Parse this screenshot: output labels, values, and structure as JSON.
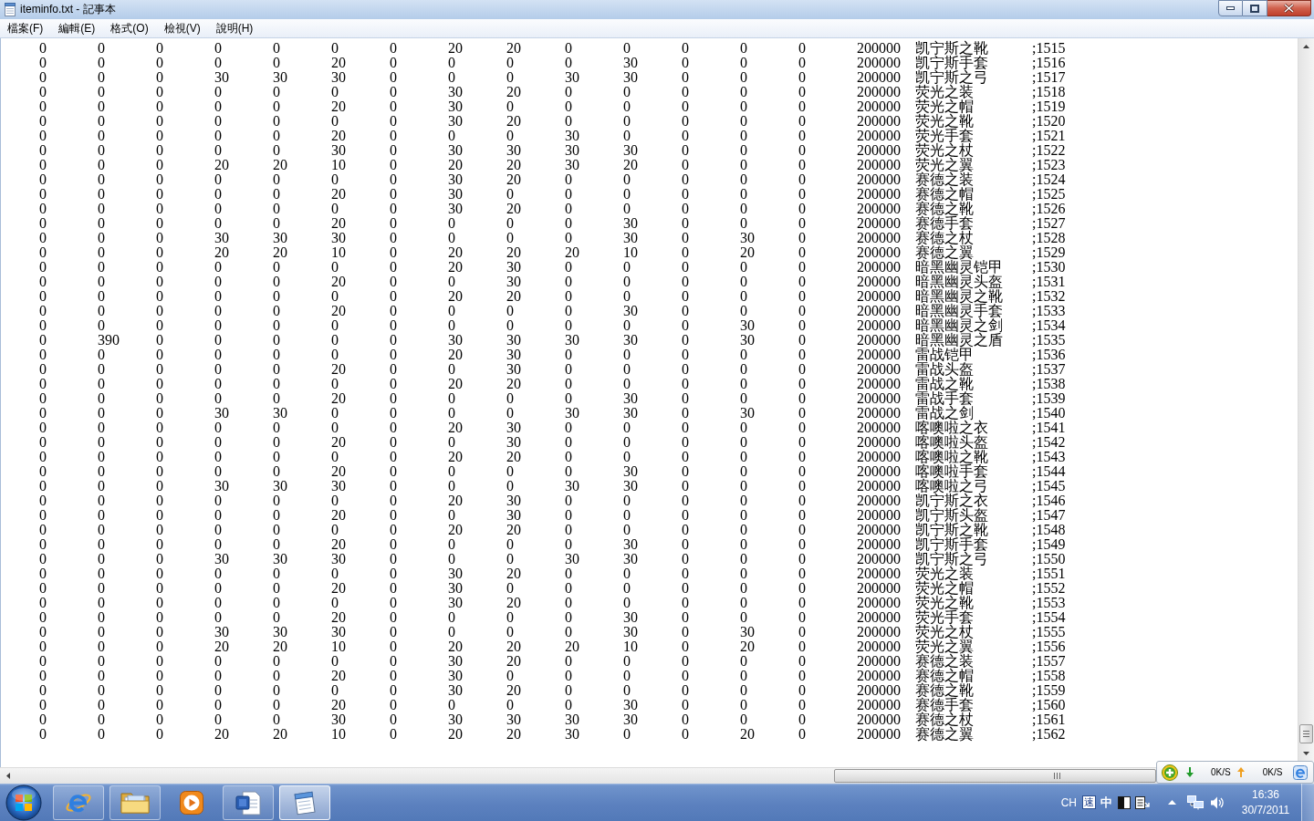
{
  "window": {
    "title": "iteminfo.txt - 記事本"
  },
  "menu": [
    "檔案(F)",
    "編輯(E)",
    "格式(O)",
    "檢視(V)",
    "說明(H)"
  ],
  "lines": [
    [
      "0",
      "0",
      "0",
      "0",
      "0",
      "0",
      "0",
      "20",
      "20",
      "0",
      "0",
      "0",
      "0",
      "0",
      "200000",
      "凯宁斯之靴",
      ";1515"
    ],
    [
      "0",
      "0",
      "0",
      "0",
      "0",
      "20",
      "0",
      "0",
      "0",
      "0",
      "30",
      "0",
      "0",
      "0",
      "200000",
      "凯宁斯手套",
      ";1516"
    ],
    [
      "0",
      "0",
      "0",
      "30",
      "30",
      "30",
      "0",
      "0",
      "0",
      "30",
      "30",
      "0",
      "0",
      "0",
      "200000",
      "凯宁斯之弓",
      ";1517"
    ],
    [
      "0",
      "0",
      "0",
      "0",
      "0",
      "0",
      "0",
      "30",
      "20",
      "0",
      "0",
      "0",
      "0",
      "0",
      "200000",
      "荧光之装",
      ";1518"
    ],
    [
      "0",
      "0",
      "0",
      "0",
      "0",
      "20",
      "0",
      "30",
      "0",
      "0",
      "0",
      "0",
      "0",
      "0",
      "200000",
      "荧光之帽",
      ";1519"
    ],
    [
      "0",
      "0",
      "0",
      "0",
      "0",
      "0",
      "0",
      "30",
      "20",
      "0",
      "0",
      "0",
      "0",
      "0",
      "200000",
      "荧光之靴",
      ";1520"
    ],
    [
      "0",
      "0",
      "0",
      "0",
      "0",
      "20",
      "0",
      "0",
      "0",
      "30",
      "0",
      "0",
      "0",
      "0",
      "200000",
      "荧光手套",
      ";1521"
    ],
    [
      "0",
      "0",
      "0",
      "0",
      "0",
      "30",
      "0",
      "30",
      "30",
      "30",
      "30",
      "0",
      "0",
      "0",
      "200000",
      "荧光之杖",
      ";1522"
    ],
    [
      "0",
      "0",
      "0",
      "20",
      "20",
      "10",
      "0",
      "20",
      "20",
      "30",
      "20",
      "0",
      "0",
      "0",
      "200000",
      "荧光之翼",
      ";1523"
    ],
    [
      "0",
      "0",
      "0",
      "0",
      "0",
      "0",
      "0",
      "30",
      "20",
      "0",
      "0",
      "0",
      "0",
      "0",
      "200000",
      "赛德之装",
      ";1524"
    ],
    [
      "0",
      "0",
      "0",
      "0",
      "0",
      "20",
      "0",
      "30",
      "0",
      "0",
      "0",
      "0",
      "0",
      "0",
      "200000",
      "赛德之帽",
      ";1525"
    ],
    [
      "0",
      "0",
      "0",
      "0",
      "0",
      "0",
      "0",
      "30",
      "20",
      "0",
      "0",
      "0",
      "0",
      "0",
      "200000",
      "赛德之靴",
      ";1526"
    ],
    [
      "0",
      "0",
      "0",
      "0",
      "0",
      "20",
      "0",
      "0",
      "0",
      "0",
      "30",
      "0",
      "0",
      "0",
      "200000",
      "赛德手套",
      ";1527"
    ],
    [
      "0",
      "0",
      "0",
      "30",
      "30",
      "30",
      "0",
      "0",
      "0",
      "0",
      "30",
      "0",
      "30",
      "0",
      "200000",
      "赛德之杖",
      ";1528"
    ],
    [
      "0",
      "0",
      "0",
      "20",
      "20",
      "10",
      "0",
      "20",
      "20",
      "20",
      "10",
      "0",
      "20",
      "0",
      "200000",
      "赛德之翼",
      ";1529"
    ],
    [
      "0",
      "0",
      "0",
      "0",
      "0",
      "0",
      "0",
      "20",
      "30",
      "0",
      "0",
      "0",
      "0",
      "0",
      "200000",
      "暗黑幽灵铠甲",
      ";1530"
    ],
    [
      "0",
      "0",
      "0",
      "0",
      "0",
      "20",
      "0",
      "0",
      "30",
      "0",
      "0",
      "0",
      "0",
      "0",
      "200000",
      "暗黑幽灵头盔",
      ";1531"
    ],
    [
      "0",
      "0",
      "0",
      "0",
      "0",
      "0",
      "0",
      "20",
      "20",
      "0",
      "0",
      "0",
      "0",
      "0",
      "200000",
      "暗黑幽灵之靴",
      ";1532"
    ],
    [
      "0",
      "0",
      "0",
      "0",
      "0",
      "20",
      "0",
      "0",
      "0",
      "0",
      "30",
      "0",
      "0",
      "0",
      "200000",
      "暗黑幽灵手套",
      ";1533"
    ],
    [
      "0",
      "0",
      "0",
      "0",
      "0",
      "0",
      "0",
      "0",
      "0",
      "0",
      "0",
      "0",
      "30",
      "0",
      "200000",
      "暗黑幽灵之剑",
      ";1534"
    ],
    [
      "0",
      "390",
      "0",
      "0",
      "0",
      "0",
      "0",
      "30",
      "30",
      "30",
      "30",
      "0",
      "30",
      "0",
      "200000",
      "暗黑幽灵之盾",
      ";1535"
    ],
    [
      "0",
      "0",
      "0",
      "0",
      "0",
      "0",
      "0",
      "20",
      "30",
      "0",
      "0",
      "0",
      "0",
      "0",
      "200000",
      "雷战铠甲",
      ";1536"
    ],
    [
      "0",
      "0",
      "0",
      "0",
      "0",
      "20",
      "0",
      "0",
      "30",
      "0",
      "0",
      "0",
      "0",
      "0",
      "200000",
      "雷战头盔",
      ";1537"
    ],
    [
      "0",
      "0",
      "0",
      "0",
      "0",
      "0",
      "0",
      "20",
      "20",
      "0",
      "0",
      "0",
      "0",
      "0",
      "200000",
      "雷战之靴",
      ";1538"
    ],
    [
      "0",
      "0",
      "0",
      "0",
      "0",
      "20",
      "0",
      "0",
      "0",
      "0",
      "30",
      "0",
      "0",
      "0",
      "200000",
      "雷战手套",
      ";1539"
    ],
    [
      "0",
      "0",
      "0",
      "30",
      "30",
      "0",
      "0",
      "0",
      "0",
      "30",
      "30",
      "0",
      "30",
      "0",
      "200000",
      "雷战之剑",
      ";1540"
    ],
    [
      "0",
      "0",
      "0",
      "0",
      "0",
      "0",
      "0",
      "20",
      "30",
      "0",
      "0",
      "0",
      "0",
      "0",
      "200000",
      "喀噢啦之衣",
      ";1541"
    ],
    [
      "0",
      "0",
      "0",
      "0",
      "0",
      "20",
      "0",
      "0",
      "30",
      "0",
      "0",
      "0",
      "0",
      "0",
      "200000",
      "喀噢啦头盔",
      ";1542"
    ],
    [
      "0",
      "0",
      "0",
      "0",
      "0",
      "0",
      "0",
      "20",
      "20",
      "0",
      "0",
      "0",
      "0",
      "0",
      "200000",
      "喀噢啦之靴",
      ";1543"
    ],
    [
      "0",
      "0",
      "0",
      "0",
      "0",
      "20",
      "0",
      "0",
      "0",
      "0",
      "30",
      "0",
      "0",
      "0",
      "200000",
      "喀噢啦手套",
      ";1544"
    ],
    [
      "0",
      "0",
      "0",
      "30",
      "30",
      "30",
      "0",
      "0",
      "0",
      "30",
      "30",
      "0",
      "0",
      "0",
      "200000",
      "喀噢啦之弓",
      ";1545"
    ],
    [
      "0",
      "0",
      "0",
      "0",
      "0",
      "0",
      "0",
      "20",
      "30",
      "0",
      "0",
      "0",
      "0",
      "0",
      "200000",
      "凯宁斯之衣",
      ";1546"
    ],
    [
      "0",
      "0",
      "0",
      "0",
      "0",
      "20",
      "0",
      "0",
      "30",
      "0",
      "0",
      "0",
      "0",
      "0",
      "200000",
      "凯宁斯头盔",
      ";1547"
    ],
    [
      "0",
      "0",
      "0",
      "0",
      "0",
      "0",
      "0",
      "20",
      "20",
      "0",
      "0",
      "0",
      "0",
      "0",
      "200000",
      "凯宁斯之靴",
      ";1548"
    ],
    [
      "0",
      "0",
      "0",
      "0",
      "0",
      "20",
      "0",
      "0",
      "0",
      "0",
      "30",
      "0",
      "0",
      "0",
      "200000",
      "凯宁斯手套",
      ";1549"
    ],
    [
      "0",
      "0",
      "0",
      "30",
      "30",
      "30",
      "0",
      "0",
      "0",
      "30",
      "30",
      "0",
      "0",
      "0",
      "200000",
      "凯宁斯之弓",
      ";1550"
    ],
    [
      "0",
      "0",
      "0",
      "0",
      "0",
      "0",
      "0",
      "30",
      "20",
      "0",
      "0",
      "0",
      "0",
      "0",
      "200000",
      "荧光之装",
      ";1551"
    ],
    [
      "0",
      "0",
      "0",
      "0",
      "0",
      "20",
      "0",
      "30",
      "0",
      "0",
      "0",
      "0",
      "0",
      "0",
      "200000",
      "荧光之帽",
      ";1552"
    ],
    [
      "0",
      "0",
      "0",
      "0",
      "0",
      "0",
      "0",
      "30",
      "20",
      "0",
      "0",
      "0",
      "0",
      "0",
      "200000",
      "荧光之靴",
      ";1553"
    ],
    [
      "0",
      "0",
      "0",
      "0",
      "0",
      "20",
      "0",
      "0",
      "0",
      "0",
      "30",
      "0",
      "0",
      "0",
      "200000",
      "荧光手套",
      ";1554"
    ],
    [
      "0",
      "0",
      "0",
      "30",
      "30",
      "30",
      "0",
      "0",
      "0",
      "0",
      "30",
      "0",
      "30",
      "0",
      "200000",
      "荧光之杖",
      ";1555"
    ],
    [
      "0",
      "0",
      "0",
      "20",
      "20",
      "10",
      "0",
      "20",
      "20",
      "20",
      "10",
      "0",
      "20",
      "0",
      "200000",
      "荧光之翼",
      ";1556"
    ],
    [
      "0",
      "0",
      "0",
      "0",
      "0",
      "0",
      "0",
      "30",
      "20",
      "0",
      "0",
      "0",
      "0",
      "0",
      "200000",
      "赛德之装",
      ";1557"
    ],
    [
      "0",
      "0",
      "0",
      "0",
      "0",
      "20",
      "0",
      "30",
      "0",
      "0",
      "0",
      "0",
      "0",
      "0",
      "200000",
      "赛德之帽",
      ";1558"
    ],
    [
      "0",
      "0",
      "0",
      "0",
      "0",
      "0",
      "0",
      "30",
      "20",
      "0",
      "0",
      "0",
      "0",
      "0",
      "200000",
      "赛德之靴",
      ";1559"
    ],
    [
      "0",
      "0",
      "0",
      "0",
      "0",
      "20",
      "0",
      "0",
      "0",
      "0",
      "30",
      "0",
      "0",
      "0",
      "200000",
      "赛德手套",
      ";1560"
    ],
    [
      "0",
      "0",
      "0",
      "0",
      "0",
      "30",
      "0",
      "30",
      "30",
      "30",
      "30",
      "0",
      "0",
      "0",
      "200000",
      "赛德之杖",
      ";1561"
    ],
    [
      "0",
      "0",
      "0",
      "20",
      "20",
      "10",
      "0",
      "20",
      "20",
      "30",
      "0",
      "0",
      "20",
      "0",
      "200000",
      "赛德之翼",
      ";1562"
    ]
  ],
  "speed_widget": {
    "download": "0K/S",
    "upload": "0K/S"
  },
  "taskbar": {
    "apps": [
      {
        "kind": "ie",
        "running": true,
        "active": false
      },
      {
        "kind": "explorer",
        "running": true,
        "active": false
      },
      {
        "kind": "media_player",
        "running": false,
        "active": false
      },
      {
        "kind": "word",
        "running": true,
        "active": false
      },
      {
        "kind": "notepad",
        "running": true,
        "active": true
      }
    ],
    "tray": {
      "language": "CH",
      "ime_tool": "速",
      "ime_mode": "中",
      "time": "16:36",
      "date": "30/7/2011"
    }
  }
}
